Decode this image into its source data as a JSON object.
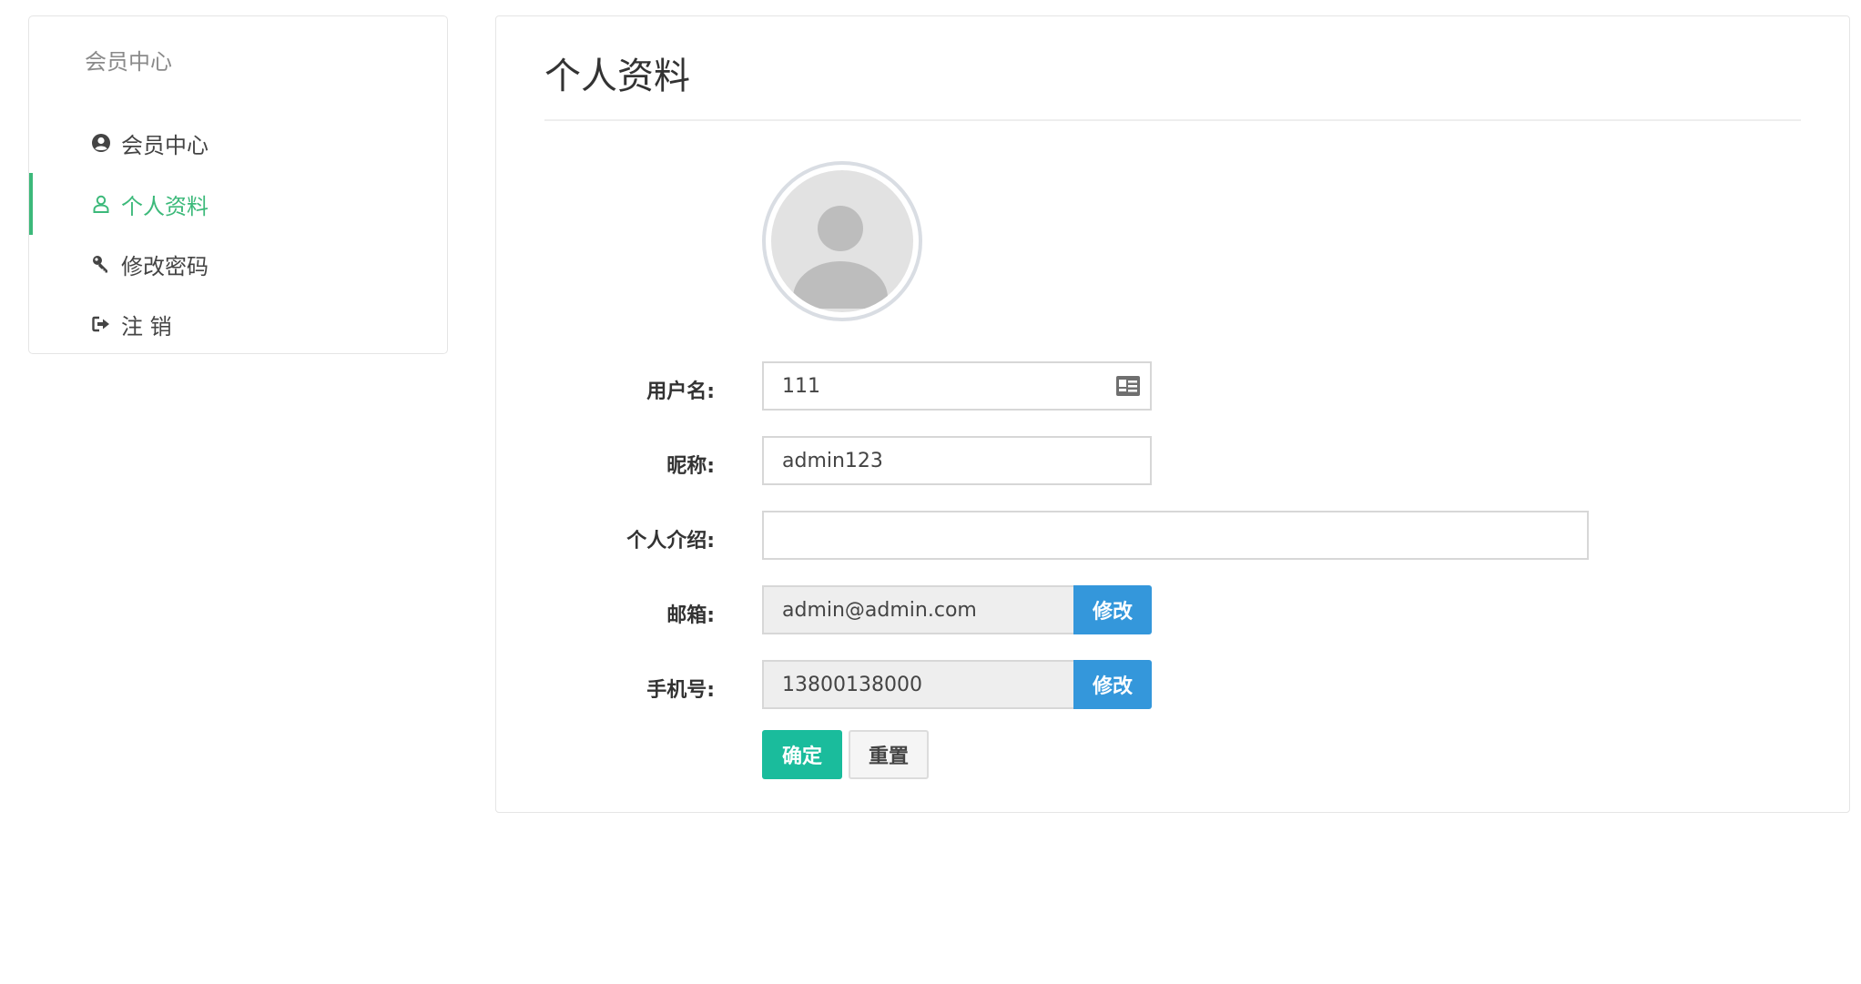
{
  "sidebar": {
    "heading": "会员中心",
    "items": [
      {
        "label": "会员中心",
        "icon": "user-circle-icon",
        "active": false
      },
      {
        "label": "个人资料",
        "icon": "user-outline-icon",
        "active": true
      },
      {
        "label": "修改密码",
        "icon": "key-icon",
        "active": false
      },
      {
        "label": "注 销",
        "icon": "sign-out-icon",
        "active": false
      }
    ]
  },
  "main": {
    "title": "个人资料",
    "avatar_icon": "default-avatar",
    "form": {
      "username": {
        "label": "用户名:",
        "value": "111",
        "icon": "id-card-icon"
      },
      "nickname": {
        "label": "昵称:",
        "value": "admin123"
      },
      "bio": {
        "label": "个人介绍:",
        "value": ""
      },
      "email": {
        "label": "邮箱:",
        "value": "admin@admin.com",
        "action": "修改"
      },
      "mobile": {
        "label": "手机号:",
        "value": "13800138000",
        "action": "修改"
      }
    },
    "buttons": {
      "confirm": "确定",
      "reset": "重置"
    }
  },
  "colors": {
    "accent_green": "#3cb97a",
    "confirm_teal": "#1abc9c",
    "action_blue": "#3497db"
  }
}
